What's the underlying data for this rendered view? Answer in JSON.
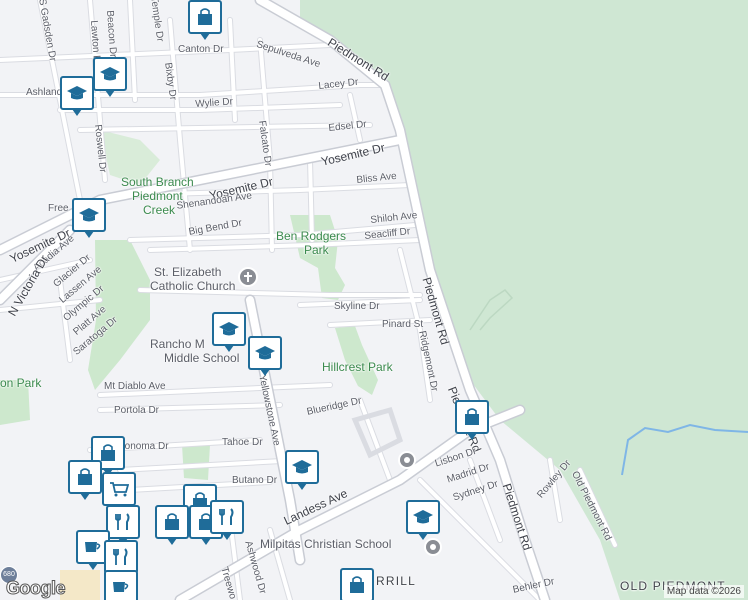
{
  "map": {
    "attribution": "Map data ©2026",
    "logo": "Google",
    "highway_shield": "680"
  },
  "streets": {
    "piedmont_rd_top": "Piedmont Rd",
    "piedmont_rd_mid": "Piedmont Rd",
    "piedmont_rd_low": "Piedmont Rd",
    "piedmont_rd_bottom": "Piedmont Rd",
    "piedmont_rd_bottom2": "Piedmont Rd",
    "old_piedmont_rd": "Old Piedmont Rd",
    "yosemite_dr_right": "Yosemite Dr",
    "yosemite_dr_mid": "Yosemite Dr",
    "yosemite_dr_left": "Yosemite Dr",
    "canton_dr": "Canton Dr",
    "sepulveda_ave": "Sepulveda Ave",
    "lacey_dr": "Lacey Dr",
    "wylie_dr": "Wylie Dr",
    "edsel_dr": "Edsel Dr",
    "falcato_dr": "Falcato Dr",
    "bixby_dr": "Bixby Dr",
    "beacon_dr": "Beacon Dr",
    "lawton_dr": "Lawton Dr",
    "gadsden_dr": "S Gadsden Dr",
    "temple_dr": "Temple Dr",
    "ashland": "Ashland",
    "roswell_dr": "Roswell Dr",
    "bliss_ave": "Bliss Ave",
    "shenandoah_ave": "Shenandoah Ave",
    "shiloh_ave": "Shiloh Ave",
    "seacliff_dr": "Seacliff Dr",
    "big_bend_dr": "Big Bend Dr",
    "free": "Free",
    "acadia_ave": "Acadia Ave",
    "glacier_dr": "Glacier Dr",
    "lassen_ave": "Lassen Ave",
    "olympic_dr": "Olympic Dr",
    "platt_ave": "Platt Ave",
    "saratoga_dr": "Saratoga Dr",
    "victoria_dr": "N Victoria Dr",
    "skyline_dr": "Skyline Dr",
    "pinard_st": "Pinard St",
    "ridgemont_dr": "Ridgemont Dr",
    "yellowstone_ave": "Yellowstone Ave",
    "mt_diablo_ave": "Mt Diablo Ave",
    "portola_dr": "Portola Dr",
    "blueridge_dr": "Blueridge Dr",
    "sonoma_dr": "Sonoma Dr",
    "tahoe_dr": "Tahoe Dr",
    "butano_dr": "Butano Dr",
    "landess_ave": "Landess Ave",
    "lisbon_dr": "Lisbon Dr",
    "madrid_dr": "Madrid Dr",
    "sydney_dr": "Sydney Dr",
    "rowley_dr": "Rowley Dr",
    "ashwood_dr": "Ashwood Dr",
    "treewood": "Treewo",
    "behler_dr": "Behler Dr"
  },
  "places": {
    "south_branch": "South Branch",
    "piedmont_creek_line": "Piedmont",
    "creek": "Creek",
    "ben_rodgers": "Ben Rodgers",
    "park_word": "Park",
    "st_elizabeth": "St. Elizabeth",
    "catholic_church": "Catholic Church",
    "rancho_school": "Rancho M",
    "middle_school": "Middle School",
    "hillcrest_park": "Hillcrest Park",
    "milpitas_christian": "Milpitas Christian School",
    "pinewood_park": "on Park",
    "old_piedmont_area": "OLD PIEDMONT",
    "merrill_area": "RRILL"
  },
  "colors": {
    "land": "#f2f3f6",
    "park": "#cde8cd",
    "hill": "#cfe7d3",
    "road": "#ffffff",
    "road_casing": "#dadce2",
    "pin_border": "#1f6c99",
    "water": "#7fb6e6"
  },
  "icons": {
    "school": "school-icon",
    "shopping": "shopping-bag-icon",
    "cart": "shopping-cart-icon",
    "restaurant": "restaurant-icon",
    "cafe": "cafe-icon",
    "church": "church-icon",
    "place": "place-icon"
  }
}
